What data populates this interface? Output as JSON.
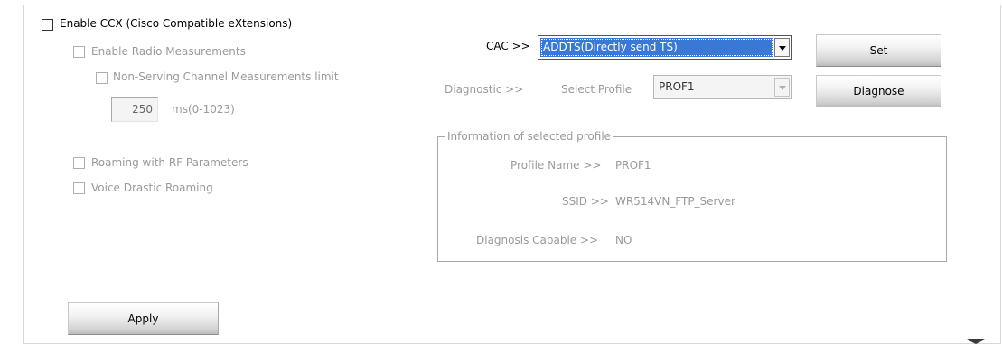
{
  "ccx": {
    "enable_label": "Enable CCX (Cisco Compatible eXtensions)",
    "enabled": false
  },
  "left": {
    "radio_measurements_label": "Enable Radio Measurements",
    "non_serving_label": "Non-Serving Channel Measurements limit",
    "limit_value": "250",
    "limit_unit": "ms(0-1023)",
    "roaming_rf_label": "Roaming with RF Parameters",
    "voice_roaming_label": "Voice Drastic Roaming",
    "apply_label": "Apply"
  },
  "cac": {
    "label": "CAC >>",
    "selected": "ADDTS(Directly send TS)",
    "set_label": "Set"
  },
  "diagnostic": {
    "label": "Diagnostic >>",
    "select_profile_label": "Select Profile",
    "selected_profile": "PROF1",
    "diagnose_label": "Diagnose"
  },
  "info": {
    "legend": "Information of selected profile",
    "profile_name_label": "Profile Name >>",
    "profile_name_value": "PROF1",
    "ssid_label": "SSID >>",
    "ssid_value": "WR514VN_FTP_Server",
    "capable_label": "Diagnosis Capable >>",
    "capable_value": "NO"
  },
  "colors": {
    "selection": "#3a78d6",
    "disabled_text": "#9a9a9a"
  }
}
